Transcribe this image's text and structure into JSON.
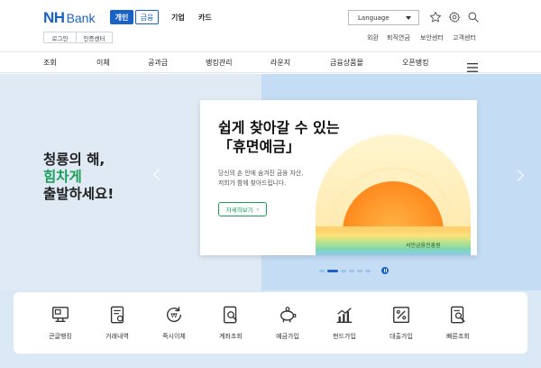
{
  "brand": {
    "nh": "NH",
    "bank": "Bank"
  },
  "header": {
    "segments": [
      "개인",
      "금융",
      "기업",
      "카드"
    ],
    "login": "로그인",
    "certificate": "인증센터",
    "language": "Language",
    "util_links": [
      "외환",
      "퇴직연금",
      "보안센터",
      "고객센터"
    ]
  },
  "nav": {
    "items": [
      "조회",
      "이체",
      "공과금",
      "뱅킹관리",
      "라운지",
      "금융상품몰",
      "오픈뱅킹"
    ]
  },
  "hero": {
    "slogan_line1": "청룡의 해,",
    "slogan_line2": "힘차게",
    "slogan_line3": "출발하세요!",
    "card_title_line1": "쉽게 찾아갈 수 있는",
    "card_title_line2": "「휴면예금」",
    "card_desc_line1": "당신의 손 안에 숨겨진 금융 자산,",
    "card_desc_line2": "저희가 함께 찾아드립니다.",
    "card_button": "자세히보기",
    "sun_caption": "서민금융진흥원"
  },
  "quick_menu": [
    {
      "label": "큰글뱅킹",
      "icon": "large-text-banking-icon"
    },
    {
      "label": "거래내역",
      "icon": "transaction-history-icon"
    },
    {
      "label": "즉시이체",
      "icon": "instant-transfer-icon"
    },
    {
      "label": "계좌조회",
      "icon": "account-inquiry-icon"
    },
    {
      "label": "예금가입",
      "icon": "deposit-piggy-icon"
    },
    {
      "label": "펀드가입",
      "icon": "fund-chart-icon"
    },
    {
      "label": "대출가입",
      "icon": "loan-percent-icon"
    },
    {
      "label": "빠른조회",
      "icon": "quick-search-icon"
    }
  ],
  "colors": {
    "brand_blue": "#1a63c6",
    "accent_green": "#1aa05a"
  }
}
